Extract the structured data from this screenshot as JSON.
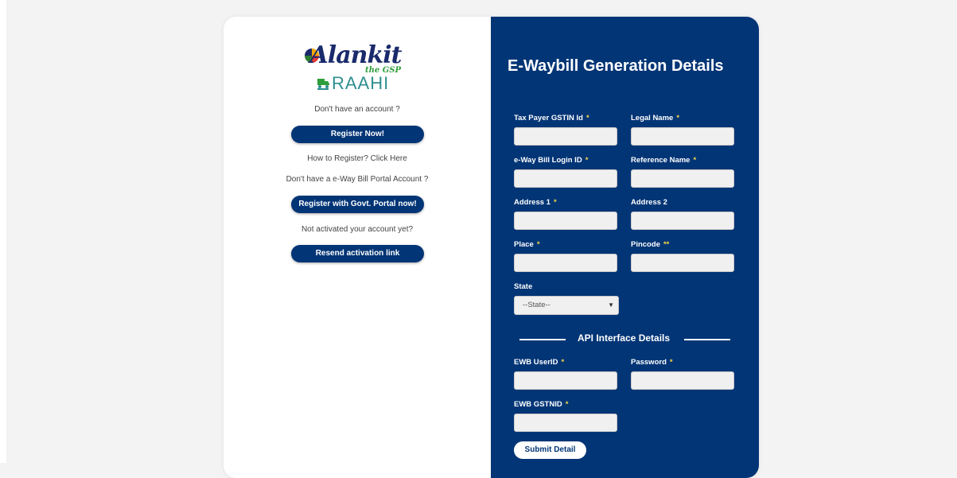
{
  "brand": {
    "logo_text": "Alankit",
    "logo_tagline": "the GSP",
    "product_name": "RAAHI"
  },
  "left": {
    "no_account_text": "Don't have an account ?",
    "register_now_label": "Register Now!",
    "how_to_register_text": "How to Register? Click Here",
    "no_portal_account_text": "Don't have a e-Way Bill Portal Account ?",
    "register_govt_label": "Register with Govt. Portal now!",
    "not_activated_text": "Not activated your account yet?",
    "resend_label": "Resend activation link"
  },
  "form": {
    "title": "E-Waybill Generation Details",
    "required_mark": "*",
    "pincode_mark": "**",
    "fields": {
      "gstin": {
        "label": "Tax Payer GSTIN Id",
        "value": ""
      },
      "legal_name": {
        "label": "Legal Name",
        "value": ""
      },
      "ewb_login": {
        "label": "e-Way Bill Login ID",
        "value": ""
      },
      "reference_name": {
        "label": "Reference Name",
        "value": ""
      },
      "address1": {
        "label": "Address 1",
        "value": ""
      },
      "address2": {
        "label": "Address 2",
        "value": ""
      },
      "place": {
        "label": "Place",
        "value": ""
      },
      "pincode": {
        "label": "Pincode",
        "value": ""
      },
      "state": {
        "label": "State",
        "selected": "--State--"
      },
      "ewb_userid": {
        "label": "EWB UserID",
        "value": ""
      },
      "password": {
        "label": "Password",
        "value": ""
      },
      "ewb_gstnid": {
        "label": "EWB GSTNID",
        "value": ""
      }
    },
    "api_section_title": "API Interface Details",
    "submit_label": "Submit Detail"
  },
  "colors": {
    "panel_blue": "#023576",
    "required_yellow": "#f5d547",
    "page_bg": "#f3f3f3"
  },
  "icons": {
    "select_arrow": "chevron-down-icon",
    "truck": "truck-icon"
  }
}
